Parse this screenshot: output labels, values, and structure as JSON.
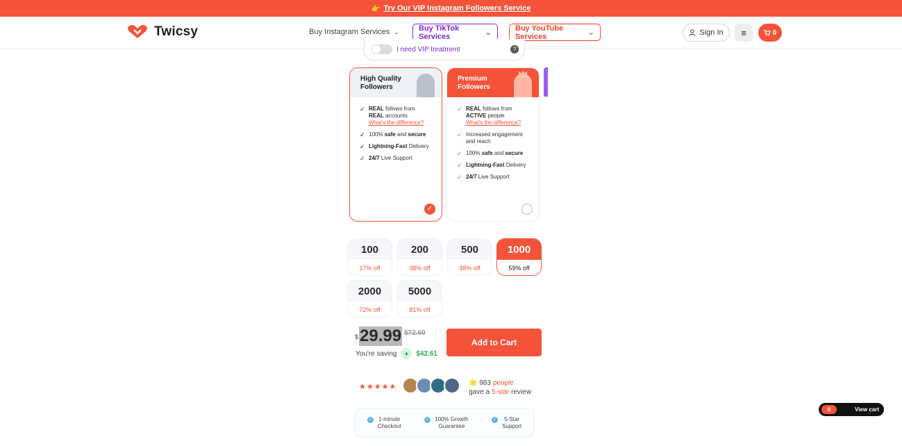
{
  "promo": {
    "emoji": "👉",
    "text": "Try Our VIP Instagram Followers Service"
  },
  "header": {
    "brand": "Twicsy",
    "nav_instagram": "Buy Instagram Services",
    "nav_tiktok": "Buy TikTok Services",
    "nav_youtube": "Buy YouTube Services",
    "sign_in": "Sign In",
    "cart_count": "0"
  },
  "vip_toggle": {
    "label": "I need VIP treatment",
    "help": "?"
  },
  "plans": [
    {
      "title_line1": "High Quality",
      "title_line2": "Followers",
      "selected": true,
      "features": [
        {
          "pre": "REAL",
          "mid": " follows from ",
          "post": "REAL",
          "tail": " accounts",
          "link": "What's the difference?"
        },
        {
          "text_html": "100% safe and secure"
        },
        {
          "text_html": "Lightning-Fast Delivery"
        },
        {
          "text_html": "24/7 Live Support"
        }
      ]
    },
    {
      "title_line1": "Premium",
      "title_line2": "Followers",
      "selected": false,
      "features": [
        {
          "pre": "REAL",
          "mid": " follows from ",
          "post": "ACTIVE",
          "tail": " people",
          "link": "What's the difference?"
        },
        {
          "text_html": "Increased engagement and reach"
        },
        {
          "text_html": "100% safe and secure"
        },
        {
          "text_html": "Lightning-Fast Delivery"
        },
        {
          "text_html": "24/7 Live Support"
        }
      ]
    }
  ],
  "quantities": [
    {
      "num": "100",
      "off": "17% off",
      "active": false
    },
    {
      "num": "200",
      "off": "38% off",
      "active": false
    },
    {
      "num": "500",
      "off": "48% off",
      "active": false
    },
    {
      "num": "1000",
      "off": "59% off",
      "active": true
    },
    {
      "num": "2000",
      "off": "72% off",
      "active": false
    },
    {
      "num": "5000",
      "off": "81% off",
      "active": false
    }
  ],
  "price": {
    "currency": "$",
    "current": "29.99",
    "old": "$72.60"
  },
  "saving": {
    "label": "You're saving",
    "amount": "$42.61"
  },
  "add_to_cart": "Add to Cart",
  "reviews": {
    "stars": "★★★★★",
    "emoji": "🌟",
    "count": "983",
    "people": "people",
    "gave": "gave a",
    "five_star": "5-star",
    "review": "review"
  },
  "benefits": [
    {
      "l1": "1-minute",
      "l2": "Checkout"
    },
    {
      "l1": "100% Growth",
      "l2": "Guarantee"
    },
    {
      "l1": "5-Star",
      "l2": "Support"
    }
  ],
  "view_cart": {
    "count": "0",
    "label": "View cart"
  },
  "colors": {
    "accent": "#f4533a",
    "tiktok": "#7a2bd4",
    "success": "#2fa84f"
  }
}
